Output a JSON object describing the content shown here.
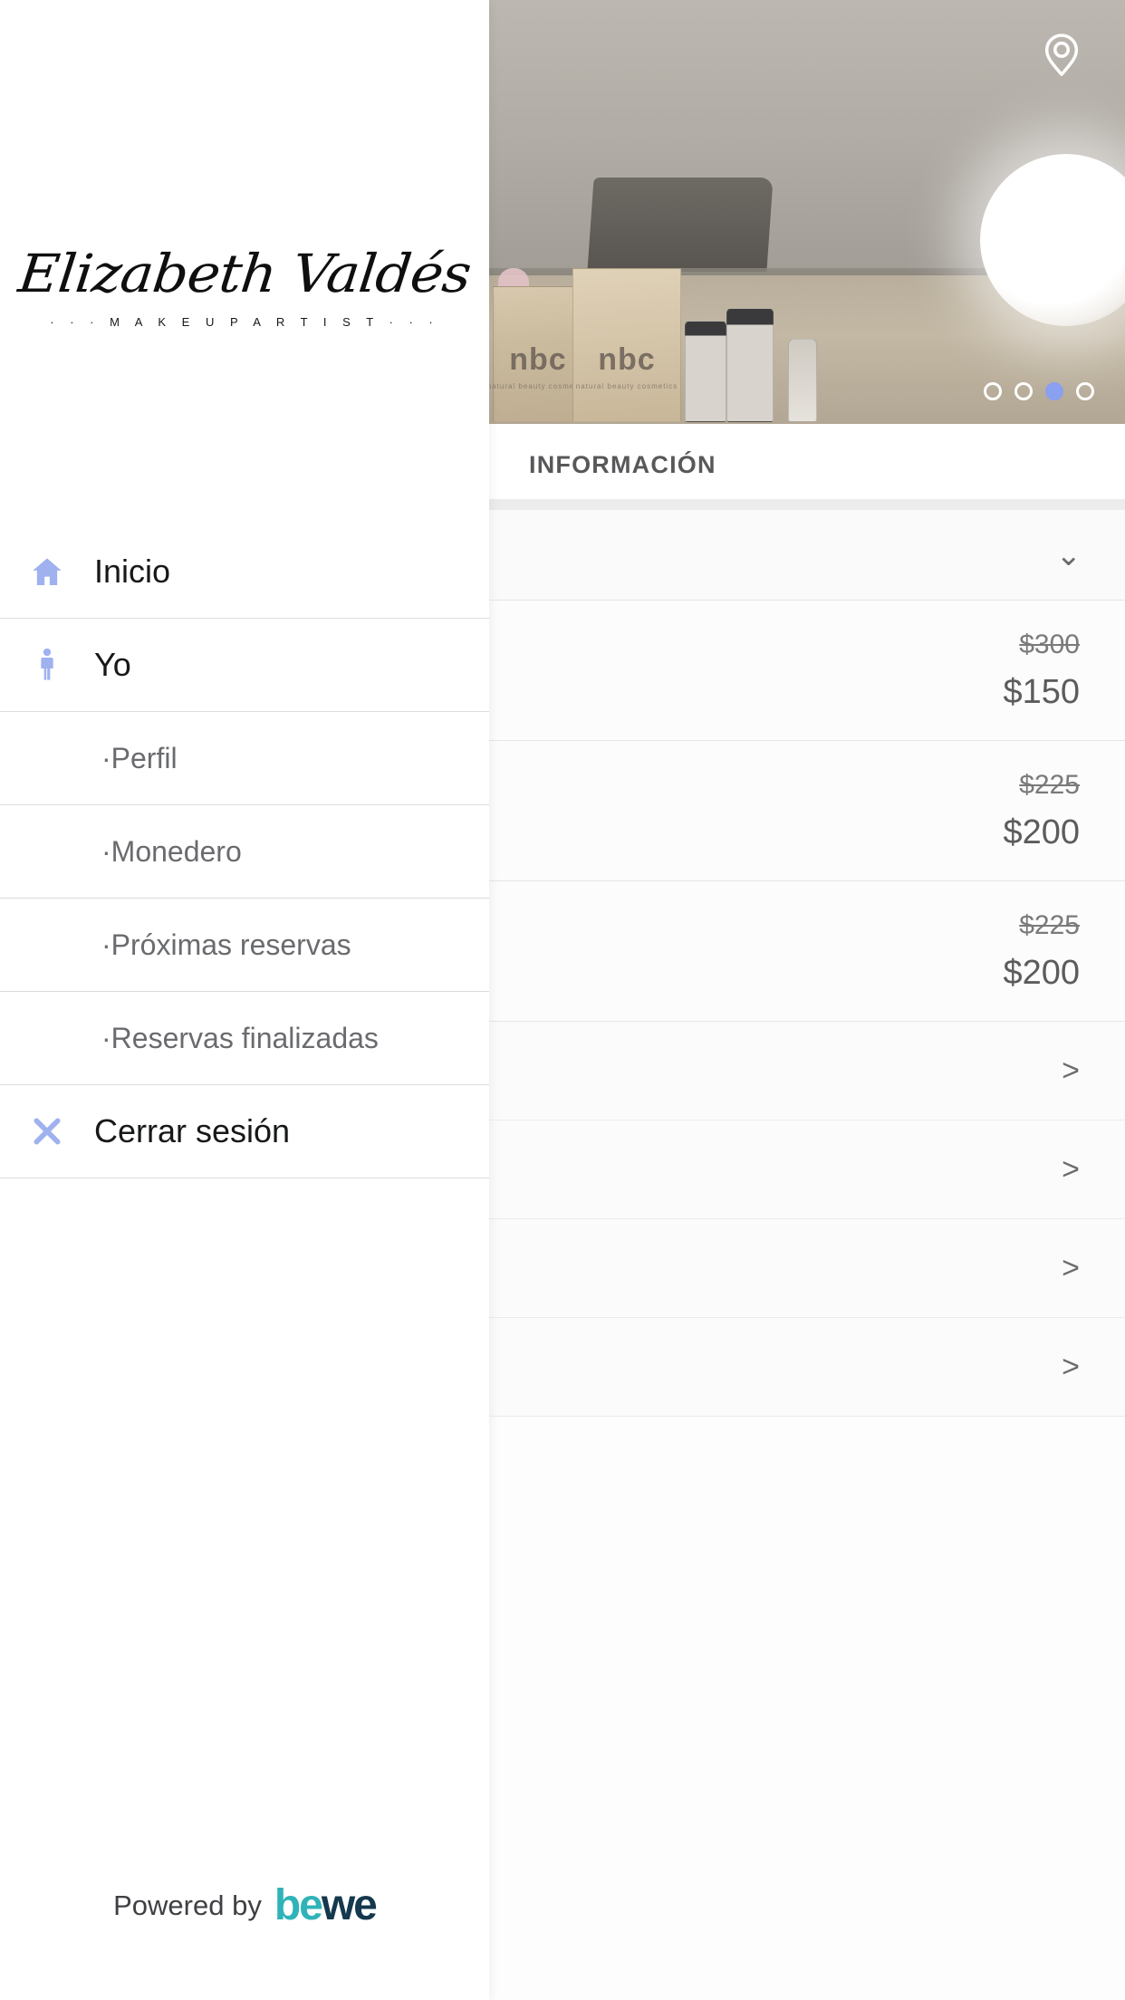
{
  "brand": {
    "logo_script": "Elizabeth Valdés",
    "logo_tagline": "· · · M A K E U P   A R T I S T · · ·"
  },
  "drawer": {
    "items": [
      {
        "label": "Inicio",
        "icon": "home-icon",
        "type": "main"
      },
      {
        "label": "Yo",
        "icon": "person-icon",
        "type": "main"
      },
      {
        "label": "·Perfil",
        "icon": "",
        "type": "sub"
      },
      {
        "label": "·Monedero",
        "icon": "",
        "type": "sub"
      },
      {
        "label": "·Próximas reservas",
        "icon": "",
        "type": "sub"
      },
      {
        "label": "·Reservas finalizadas",
        "icon": "",
        "type": "sub"
      },
      {
        "label": "Cerrar sesión",
        "icon": "close-x-icon",
        "type": "main"
      }
    ],
    "footer": {
      "powered_by": "Powered by",
      "logo_part_1": "be",
      "logo_part_2": "we"
    }
  },
  "content": {
    "pin_icon": "location-pin-icon",
    "carousel": {
      "count": 4,
      "active_index": 2
    },
    "section_title": "INFORMACIÓN",
    "collapse_chevron": "⌄",
    "price_rows": [
      {
        "old_price": "$300",
        "new_price": "$150"
      },
      {
        "old_price": "$225",
        "new_price": "$200"
      },
      {
        "old_price": "$225",
        "new_price": "$200"
      }
    ],
    "arrow_rows": [
      {
        "chevron": ">"
      },
      {
        "chevron": ">"
      },
      {
        "chevron": ">"
      },
      {
        "chevron": ">"
      }
    ],
    "hero": {
      "box1_label": "nbc",
      "box1_sub": "natural beauty cosmetics",
      "box2_label": "nbc",
      "box2_sub": "natural beauty cosmetics"
    }
  },
  "colors": {
    "accent_periwinkle": "#9fb1ef",
    "dot_active": "#8aa0f0",
    "bewe_teal": "#2fb3b8",
    "bewe_navy": "#14384d",
    "text_dark": "#17181a",
    "text_muted": "#6a6b6e"
  }
}
